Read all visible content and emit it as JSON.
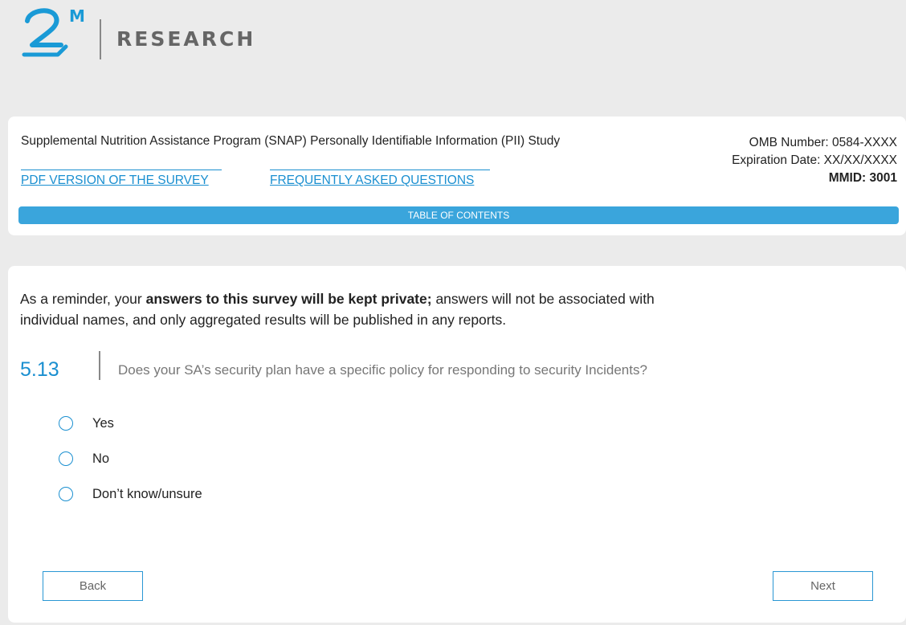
{
  "logo": {
    "mark": "2",
    "superscript": "M",
    "text": "RESEARCH",
    "color": "#1a9ad6"
  },
  "header": {
    "study_title": "Supplemental Nutrition Assistance Program (SNAP) Personally Identifiable Information (PII) Study",
    "omb_number": "OMB Number: 0584-XXXX",
    "expiration_date": "Expiration Date: XX/XX/XXXX",
    "mmid": "MMID: 3001",
    "pdf_link": "PDF VERSION OF THE SURVEY",
    "faq_link": "FREQUENTLY ASKED QUESTIONS",
    "toc_label": "TABLE OF CONTENTS"
  },
  "question": {
    "reminder_pre": "As a reminder, your ",
    "reminder_bold": "answers to this survey will be kept private;",
    "reminder_post": " answers will not be associated with individual names, and only aggregated results will be published in any reports.",
    "number": "5.13",
    "text": "Does your SA’s security plan have a specific policy for responding to security Incidents?",
    "options": [
      {
        "label": "Yes",
        "selected": false
      },
      {
        "label": "No",
        "selected": false
      },
      {
        "label": "Don’t know/unsure",
        "selected": false
      }
    ]
  },
  "nav": {
    "back_label": "Back",
    "next_label": "Next"
  },
  "colors": {
    "accent": "#1a8fd0",
    "toc_bar": "#3aa5dc",
    "page_bg": "#ebebeb"
  }
}
